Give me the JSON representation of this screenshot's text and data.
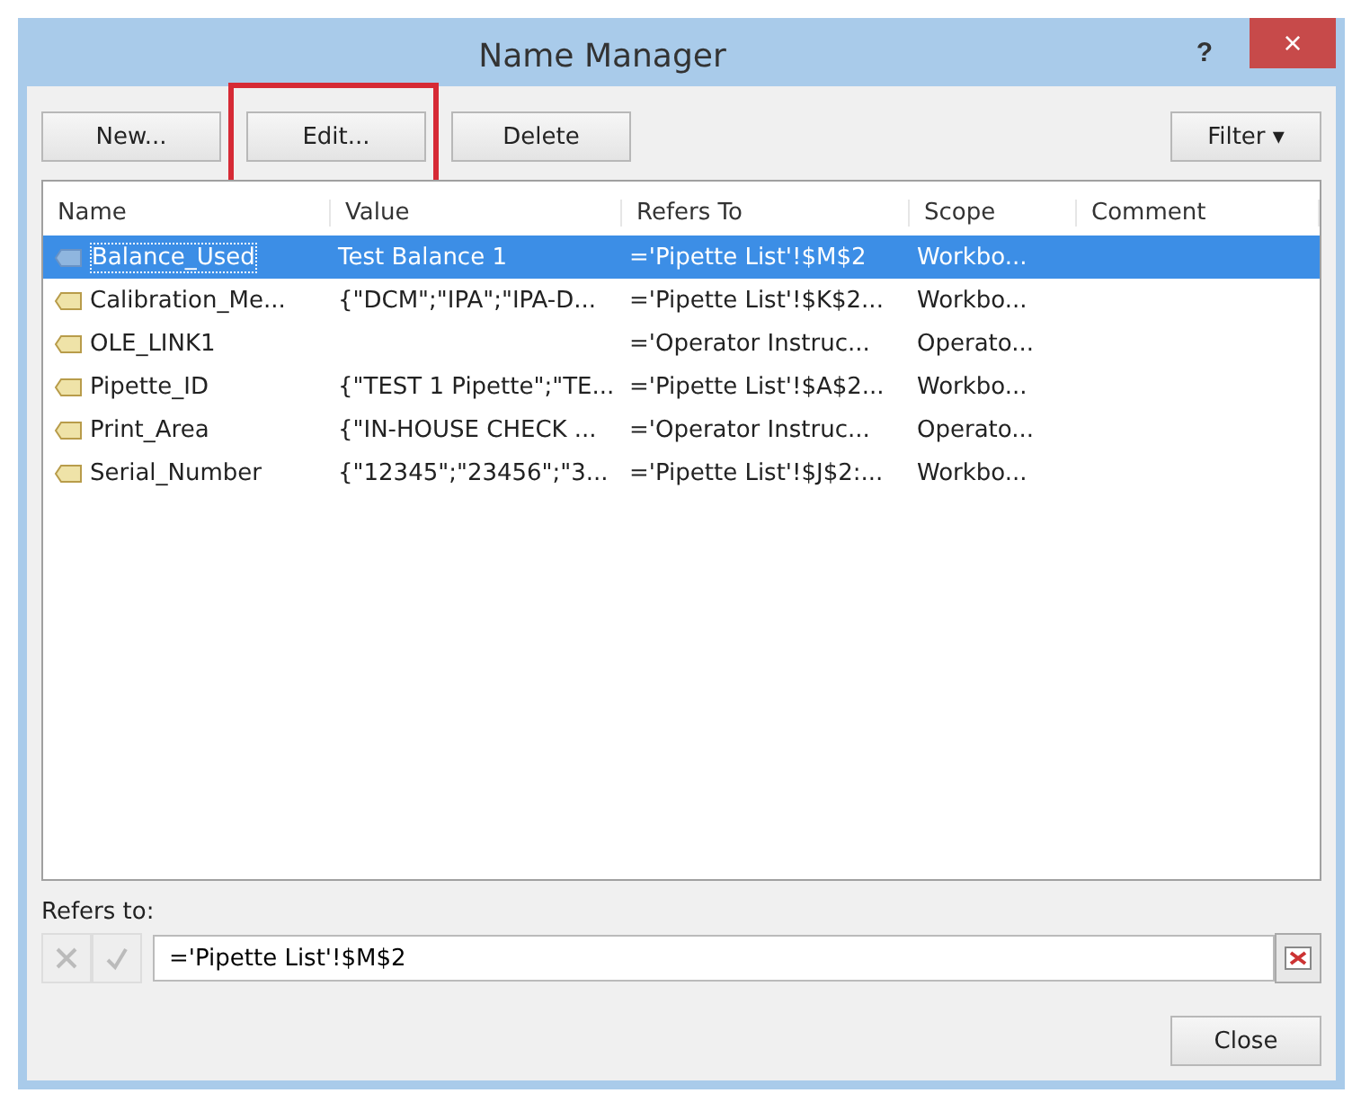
{
  "window": {
    "title": "Name Manager",
    "help": "?",
    "close": "×"
  },
  "toolbar": {
    "buttons": [
      {
        "label": "New...",
        "highlighted": false
      },
      {
        "label": "Edit...",
        "highlighted": true
      },
      {
        "label": "Delete",
        "highlighted": false
      }
    ],
    "filter": "Filter",
    "filter_caret": "▾"
  },
  "table": {
    "columns": [
      "Name",
      "Value",
      "Refers To",
      "Scope",
      "Comment"
    ],
    "rows": [
      {
        "name": "Balance_Used",
        "value": "Test Balance 1",
        "refers_to": "='Pipette List'!$M$2",
        "scope": "Workbo...",
        "selected": true
      },
      {
        "name": "Calibration_Me...",
        "value": "{\"DCM\";\"IPA\";\"IPA-D...",
        "refers_to": "='Pipette List'!$K$2...",
        "scope": "Workbo...",
        "selected": false
      },
      {
        "name": "OLE_LINK1",
        "value": "",
        "refers_to": "='Operator Instruc...",
        "scope": "Operato...",
        "selected": false
      },
      {
        "name": "Pipette_ID",
        "value": "{\"TEST 1 Pipette\";\"TE...",
        "refers_to": "='Pipette List'!$A$2...",
        "scope": "Workbo...",
        "selected": false
      },
      {
        "name": "Print_Area",
        "value": "{\"IN-HOUSE CHECK ...",
        "refers_to": "='Operator Instruc...",
        "scope": "Operato...",
        "selected": false
      },
      {
        "name": "Serial_Number",
        "value": "{\"12345\";\"23456\";\"3...",
        "refers_to": "='Pipette List'!$J$2:...",
        "scope": "Workbo...",
        "selected": false
      }
    ]
  },
  "refers_to": {
    "label": "Refers to:",
    "value": "='Pipette List'!$M$2"
  },
  "footer": {
    "close": "Close"
  }
}
